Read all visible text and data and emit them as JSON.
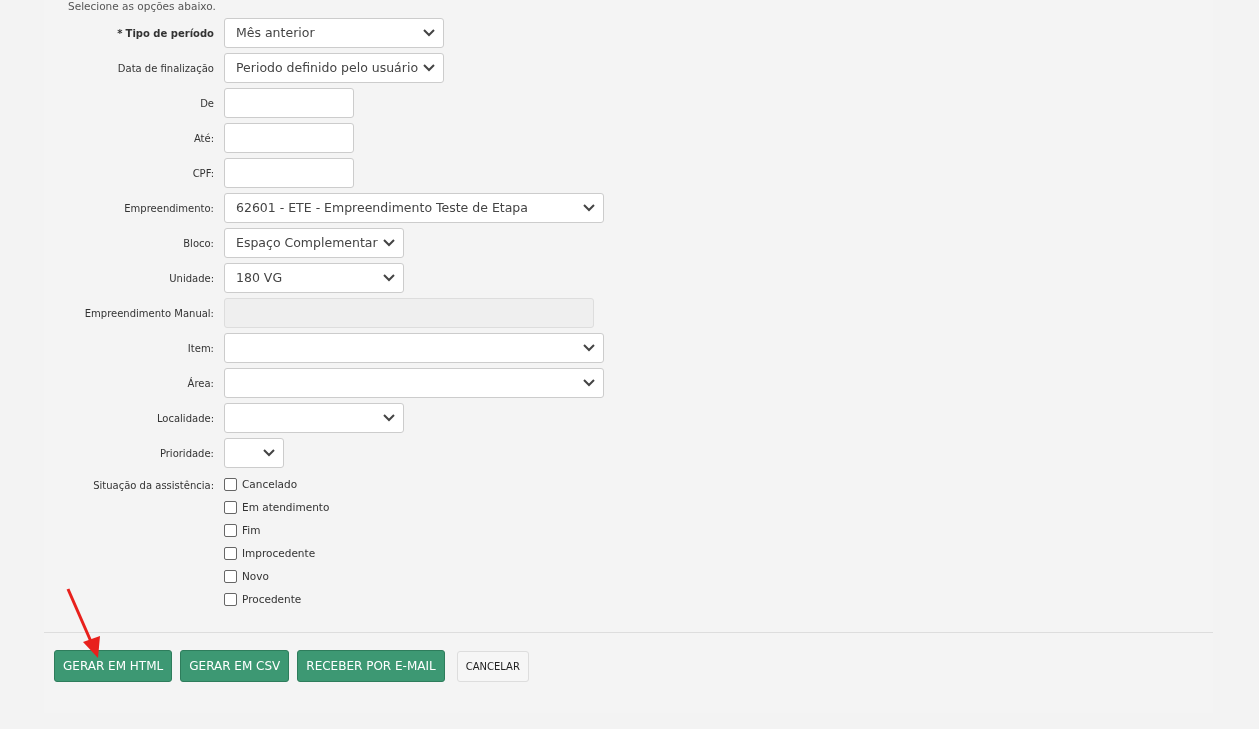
{
  "intro": "Selecione as opções abaixo.",
  "fields": [
    {
      "kind": "select",
      "label": "Tipo de período",
      "required_mark": "*",
      "value": "Mês anterior"
    },
    {
      "kind": "select",
      "label": "Data de finalização",
      "value": "Periodo definido pelo usuário"
    },
    {
      "kind": "text",
      "label": "De"
    },
    {
      "kind": "text",
      "label": "Até:"
    },
    {
      "kind": "text",
      "label": "CPF:"
    },
    {
      "kind": "select",
      "label": "Empreendimento:",
      "value": "62601 - ETE - Empreendimento Teste de Etapa"
    },
    {
      "kind": "select",
      "label": "Bloco:",
      "value": "Espaço Complementar"
    },
    {
      "kind": "select",
      "label": "Unidade:",
      "value": "180 VG"
    },
    {
      "kind": "disabled",
      "label": "Empreendimento Manual:"
    },
    {
      "kind": "select",
      "label": "Item:"
    },
    {
      "kind": "select",
      "label": "Área:"
    },
    {
      "kind": "select",
      "label": "Localidade:"
    },
    {
      "kind": "select",
      "label": "Prioridade:"
    },
    {
      "kind": "checks",
      "label": "Situação da assistência:",
      "options": [
        {
          "label": "Cancelado",
          "checked": false
        },
        {
          "label": "Em atendimento",
          "checked": false
        },
        {
          "label": "Fim",
          "checked": false
        },
        {
          "label": "Improcedente",
          "checked": false
        },
        {
          "label": "Novo",
          "checked": false
        },
        {
          "label": "Procedente",
          "checked": false
        }
      ]
    }
  ],
  "buttons": [
    {
      "label": "GERAR EM HTML",
      "kind": "primary"
    },
    {
      "label": "GERAR EM CSV",
      "kind": "primary"
    },
    {
      "label": "RECEBER POR E-MAIL",
      "kind": "primary"
    },
    {
      "label": "CANCELAR",
      "kind": "secondary"
    }
  ]
}
